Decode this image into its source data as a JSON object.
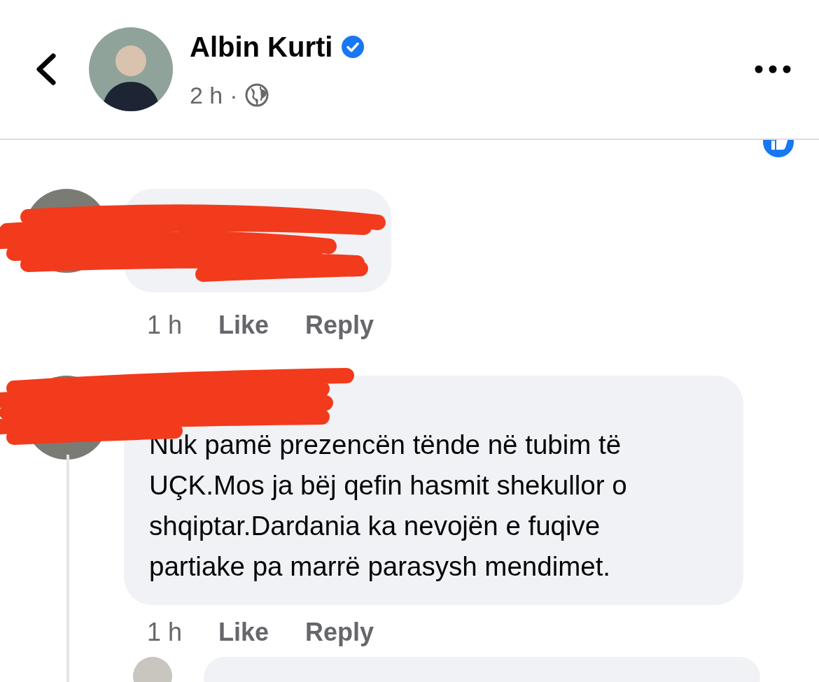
{
  "header": {
    "author": "Albin Kurti",
    "verified": true,
    "time": "2 h",
    "separator": "·"
  },
  "comments": [
    {
      "redacted": true,
      "time": "1 h",
      "actions": [
        "Like",
        "Reply"
      ]
    },
    {
      "redacted": true,
      "text_lines": [
        "Nuk pamë prezencën tënde në tubim të",
        "UÇK.Mos ja bëj qefin hasmit shekullor o",
        "shqiptar.Dardania ka nevojën e fuqive",
        "partiake pa marrë parasysh mendimet."
      ],
      "time": "1 h",
      "actions": [
        "Like",
        "Reply"
      ]
    }
  ]
}
